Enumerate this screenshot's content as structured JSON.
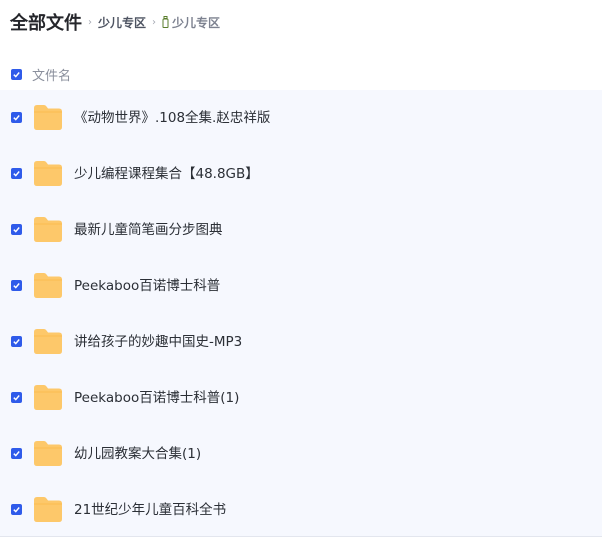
{
  "breadcrumb": {
    "root": "全部文件",
    "separator": "›",
    "parent": "少儿专区",
    "current": "少儿专区",
    "current_icon": "bottle-icon"
  },
  "list_header": {
    "label": "文件名",
    "select_all_checked": true
  },
  "files": [
    {
      "name": "《动物世界》.108全集.赵忠祥版",
      "type": "folder",
      "checked": true
    },
    {
      "name": "少儿编程课程集合【48.8GB】",
      "type": "folder",
      "checked": true
    },
    {
      "name": "最新儿童简笔画分步图典",
      "type": "folder",
      "checked": true
    },
    {
      "name": "Peekaboo百诺博士科普",
      "type": "folder",
      "checked": true
    },
    {
      "name": "讲给孩子的妙趣中国史-MP3",
      "type": "folder",
      "checked": true
    },
    {
      "name": "Peekaboo百诺博士科普(1)",
      "type": "folder",
      "checked": true
    },
    {
      "name": "幼儿园教案大合集(1)",
      "type": "folder",
      "checked": true
    },
    {
      "name": "21世纪少年儿童百科全书",
      "type": "folder",
      "checked": true
    }
  ],
  "colors": {
    "accent": "#2f5bea",
    "folder": "#fdc86a",
    "list_background": "#f6f8fe"
  }
}
